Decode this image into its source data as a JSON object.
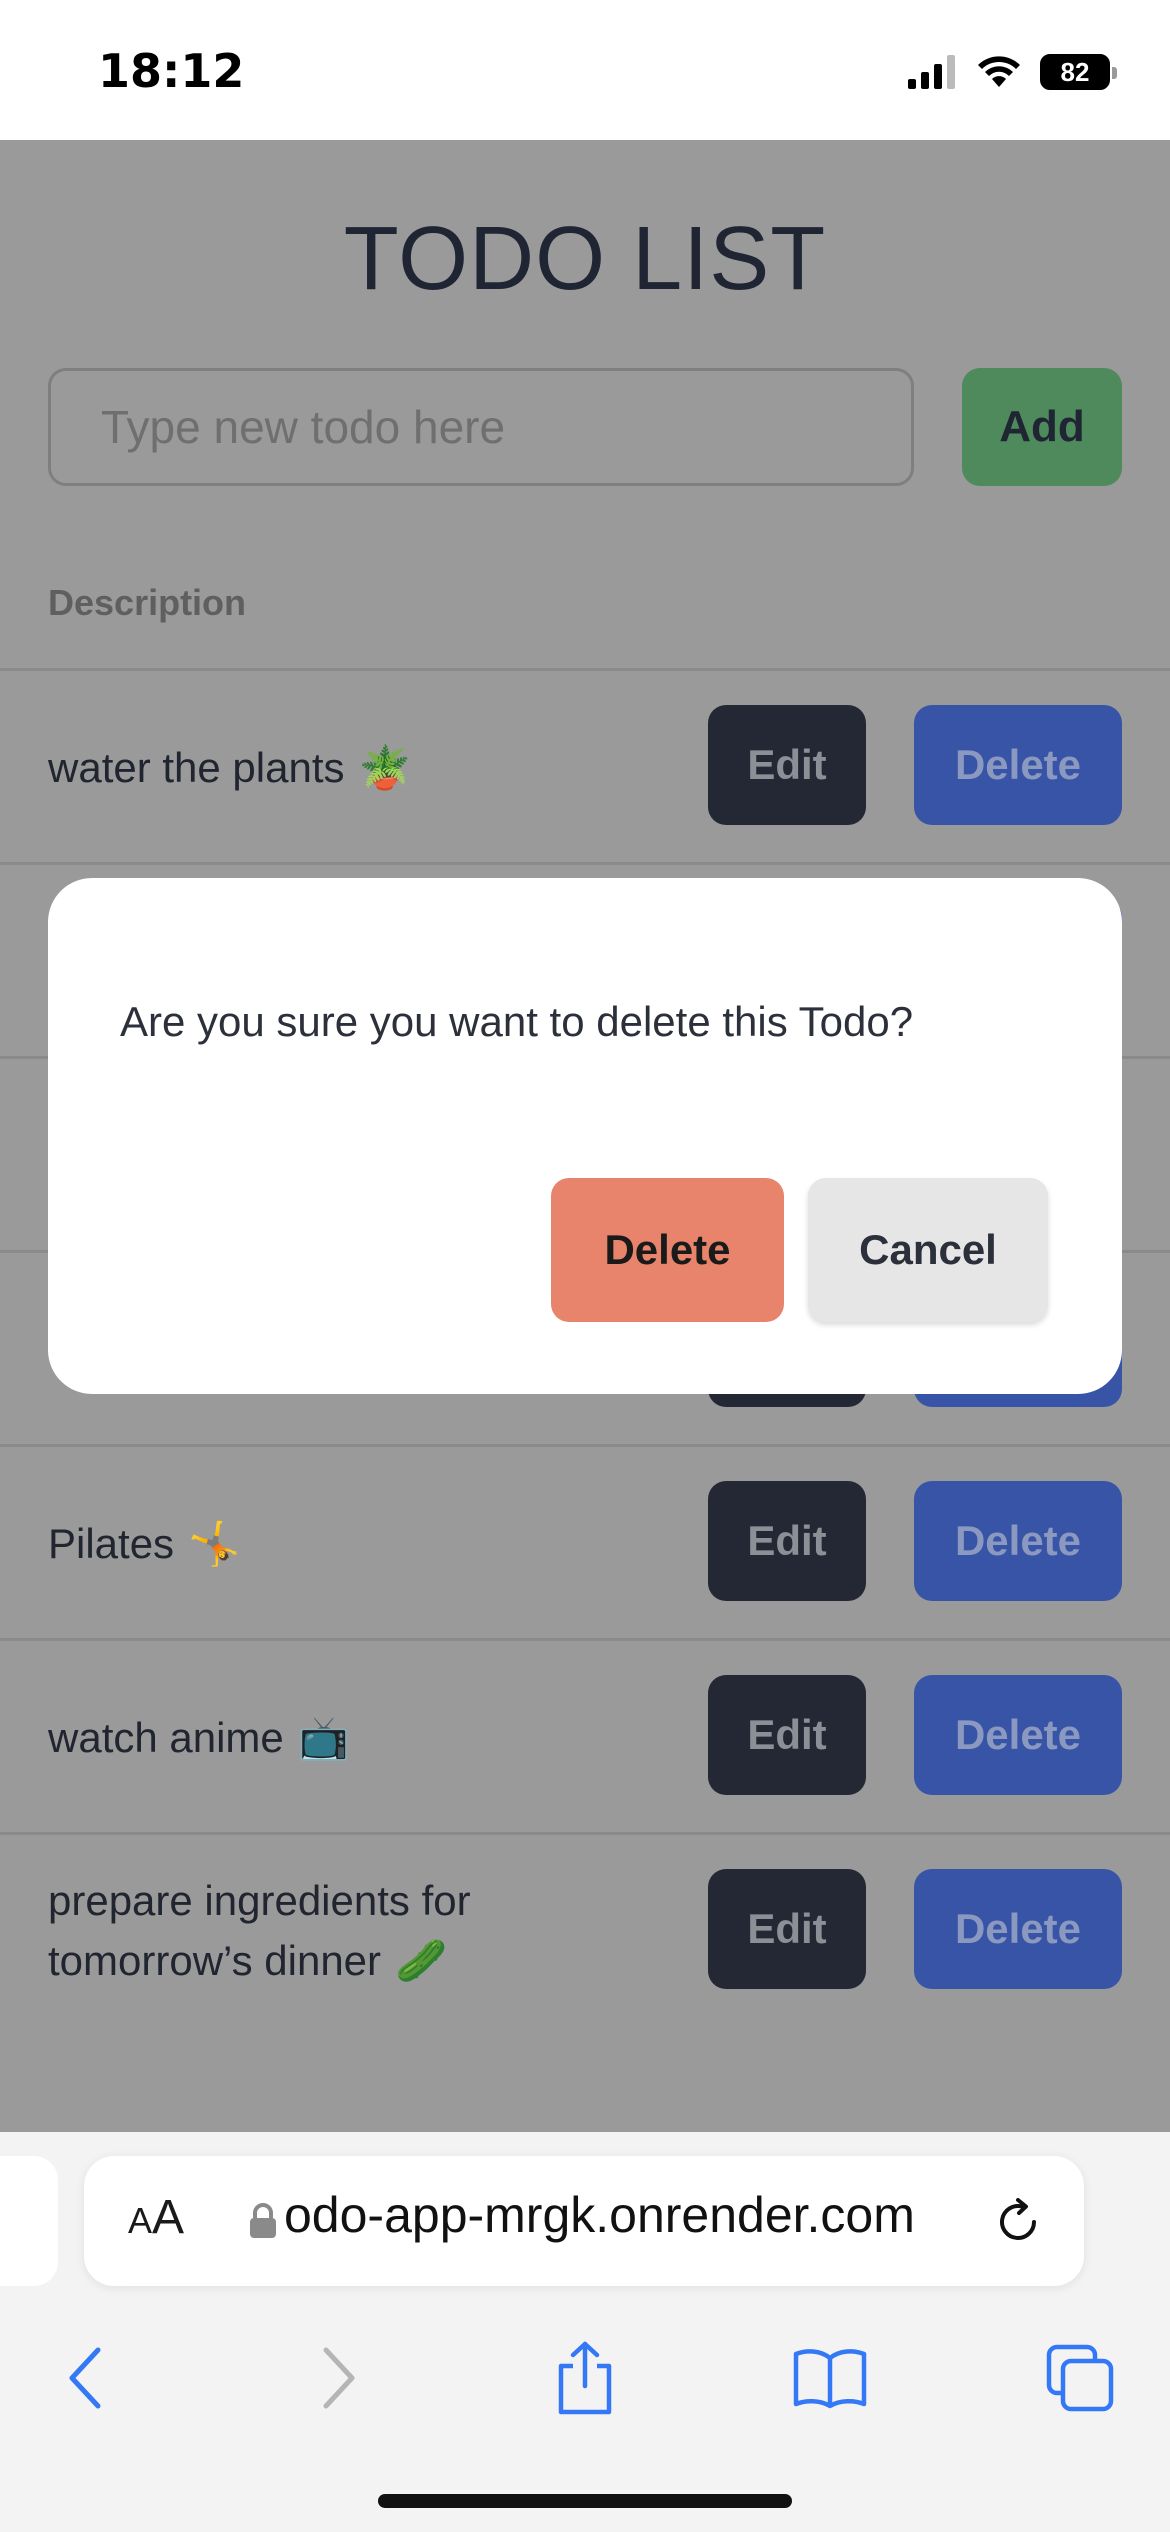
{
  "status_bar": {
    "time": "18:12",
    "battery": "82"
  },
  "app": {
    "title": "TODO LIST",
    "input_placeholder": "Type new todo here",
    "add_label": "Add",
    "column_header": "Description",
    "edit_label": "Edit",
    "delete_label": "Delete",
    "todos": [
      {
        "text": "water the plants",
        "emoji": "🪴"
      },
      {
        "text": "",
        "emoji": ""
      },
      {
        "text": "",
        "emoji": ""
      },
      {
        "text": "",
        "emoji": ""
      },
      {
        "text": "Pilates",
        "emoji": "🤸"
      },
      {
        "text": "watch anime",
        "emoji": "📺"
      },
      {
        "text": "prepare ingredients for tomorrow’s dinner",
        "emoji": "🥒"
      }
    ]
  },
  "modal": {
    "message": "Are you sure you want to delete this Todo?",
    "delete_label": "Delete",
    "cancel_label": "Cancel"
  },
  "safari": {
    "aa_label_small": "A",
    "aa_label_large": "A",
    "url": "odo-app-mrgk.onrender.com"
  },
  "colors": {
    "overlay_bg": "#9a9a9a",
    "add_button": "#4f8a5c",
    "delete_button": "#3754a6",
    "modal_delete": "#e8846b"
  }
}
